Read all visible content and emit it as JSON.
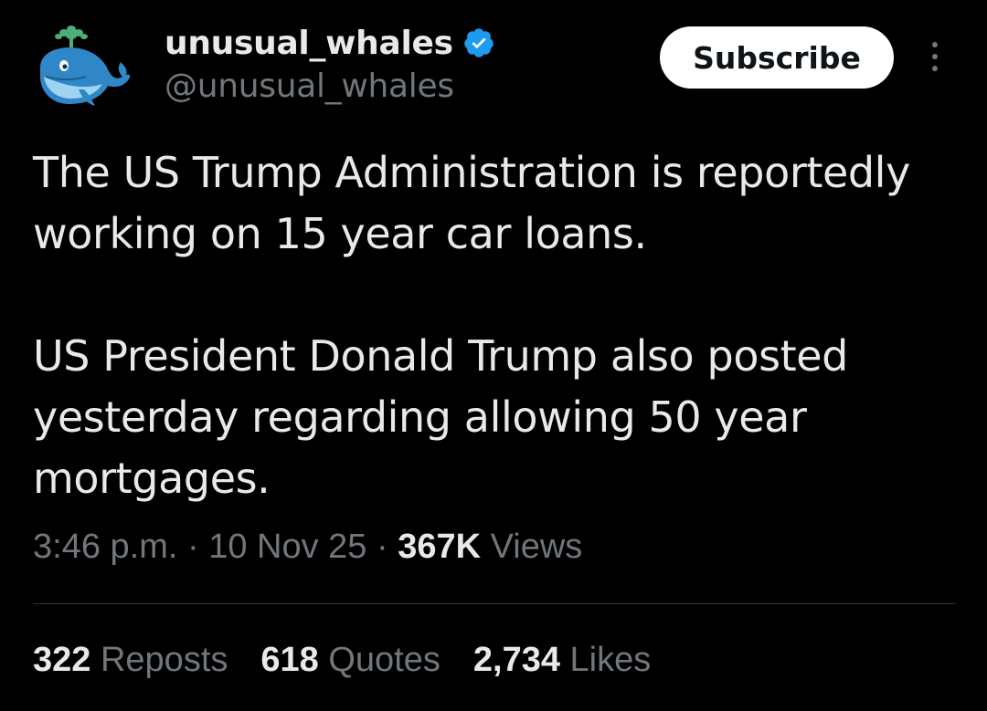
{
  "author": {
    "display_name": "unusual_whales",
    "handle": "@unusual_whales",
    "verified": true,
    "avatar": "whale-logo-icon"
  },
  "actions": {
    "subscribe_label": "Subscribe",
    "more_icon": "more-vertical-icon"
  },
  "tweet": {
    "paragraphs": [
      "The US Trump Administration is reportedly working on 15 year car loans.",
      "US President Donald Trump also posted yesterday regarding allowing 50 year mortgages."
    ],
    "time": "3:46 p.m.",
    "separator": "·",
    "date": "10 Nov 25",
    "views_count": "367K",
    "views_label": "Views"
  },
  "stats": {
    "reposts_count": "322",
    "reposts_label": "Reposts",
    "quotes_count": "618",
    "quotes_label": "Quotes",
    "likes_count": "2,734",
    "likes_label": "Likes"
  },
  "colors": {
    "background": "#000000",
    "text_primary": "#e7e9ea",
    "text_secondary": "#71767b",
    "verified_blue": "#1d9bf0",
    "button_bg": "#ffffff",
    "divider": "#2f3336"
  }
}
